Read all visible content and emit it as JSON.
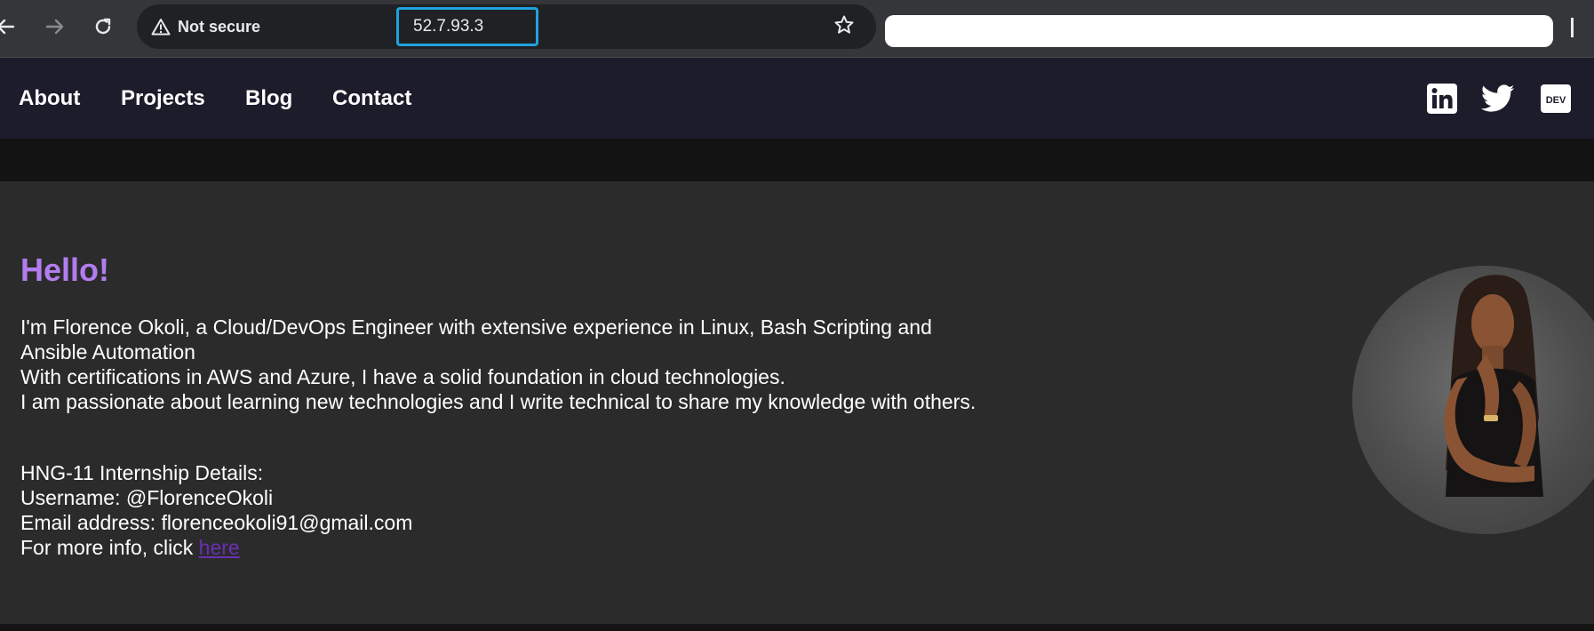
{
  "browser": {
    "security_label": "Not secure",
    "url": "52.7.93.3",
    "icons": {
      "back": "back-arrow-icon",
      "forward": "forward-arrow-icon",
      "reload": "reload-icon",
      "warning": "warning-triangle-icon",
      "bookmark": "star-icon"
    }
  },
  "nav": {
    "links": [
      "About",
      "Projects",
      "Blog",
      "Contact"
    ],
    "social": [
      "linkedin-icon",
      "twitter-icon",
      "dev-icon"
    ],
    "dev_label": "DEV"
  },
  "hero": {
    "heading": "Hello!",
    "intro_lines": [
      "I'm Florence Okoli, a Cloud/DevOps Engineer with extensive experience in Linux, Bash Scripting and Ansible Automation",
      "With certifications in AWS and Azure, I have a solid foundation in cloud technologies.",
      "I am passionate about learning new technologies and I write technical to share my knowledge with others."
    ],
    "details": {
      "title": "HNG-11 Internship Details:",
      "username": "Username: @FlorenceOkoli",
      "email": "Email address: florenceokoli91@gmail.com",
      "more_info_prefix": "For more info, click ",
      "more_info_link": "here"
    }
  },
  "colors": {
    "accent": "#b37df0",
    "nav_bg": "#1d1c2b",
    "page_bg": "#2b2b2b",
    "link": "#6a2fb5",
    "url_highlight": "#1ea3dc"
  }
}
